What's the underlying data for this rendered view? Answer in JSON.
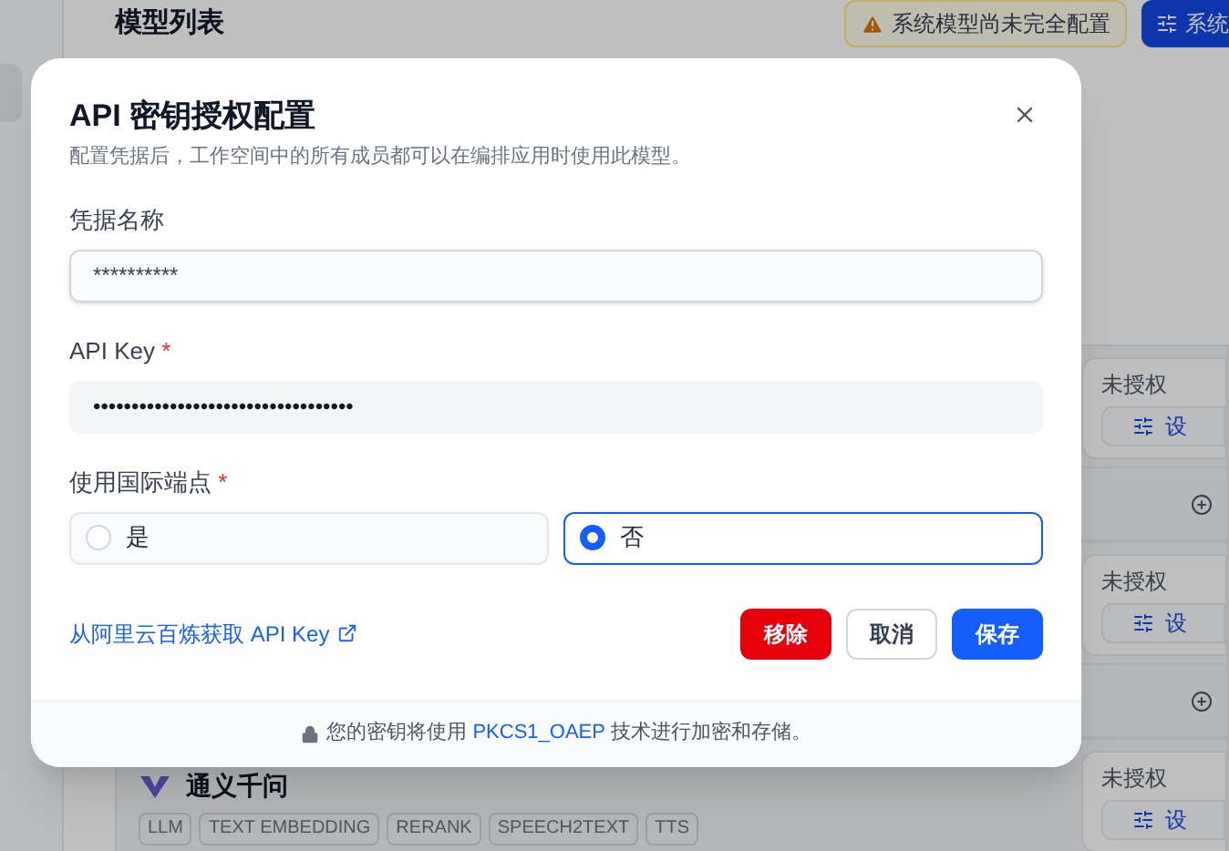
{
  "page": {
    "title": "模型列表",
    "warning_badge": "系统模型尚未完全配置",
    "system_button": "系统",
    "providers": [
      {
        "status": "未授权",
        "setup_button": "设"
      },
      {
        "status": "未授权",
        "setup_button": "设"
      },
      {
        "name": "通义千问",
        "status": "未授权",
        "setup_button": "设",
        "tags": [
          "LLM",
          "TEXT EMBEDDING",
          "RERANK",
          "SPEECH2TEXT",
          "TTS"
        ]
      }
    ]
  },
  "dialog": {
    "title": "API 密钥授权配置",
    "subtitle": "配置凭据后，工作空间中的所有成员都可以在编排应用时使用此模型。",
    "fields": [
      {
        "kind": "text",
        "label": "凭据名称",
        "value": "**********",
        "focused": true
      },
      {
        "kind": "password",
        "label": "API Key",
        "required_mark": "*",
        "value": "••••••••••••••••••••••••••••••••••",
        "focused": false
      },
      {
        "kind": "radio",
        "label": "使用国际端点",
        "required_mark": "*",
        "options": [
          {
            "label": "是",
            "selected": false
          },
          {
            "label": "否",
            "selected": true
          }
        ]
      }
    ],
    "help_link": "从阿里云百炼获取 API Key",
    "buttons": [
      {
        "kind": "danger",
        "label": "移除"
      },
      {
        "kind": "secondary",
        "label": "取消"
      },
      {
        "kind": "primary",
        "label": "保存"
      }
    ],
    "security_note": {
      "prefix": "您的密钥将使用",
      "highlight": "PKCS1_OAEP",
      "suffix": "技术进行加密和存储。"
    }
  }
}
